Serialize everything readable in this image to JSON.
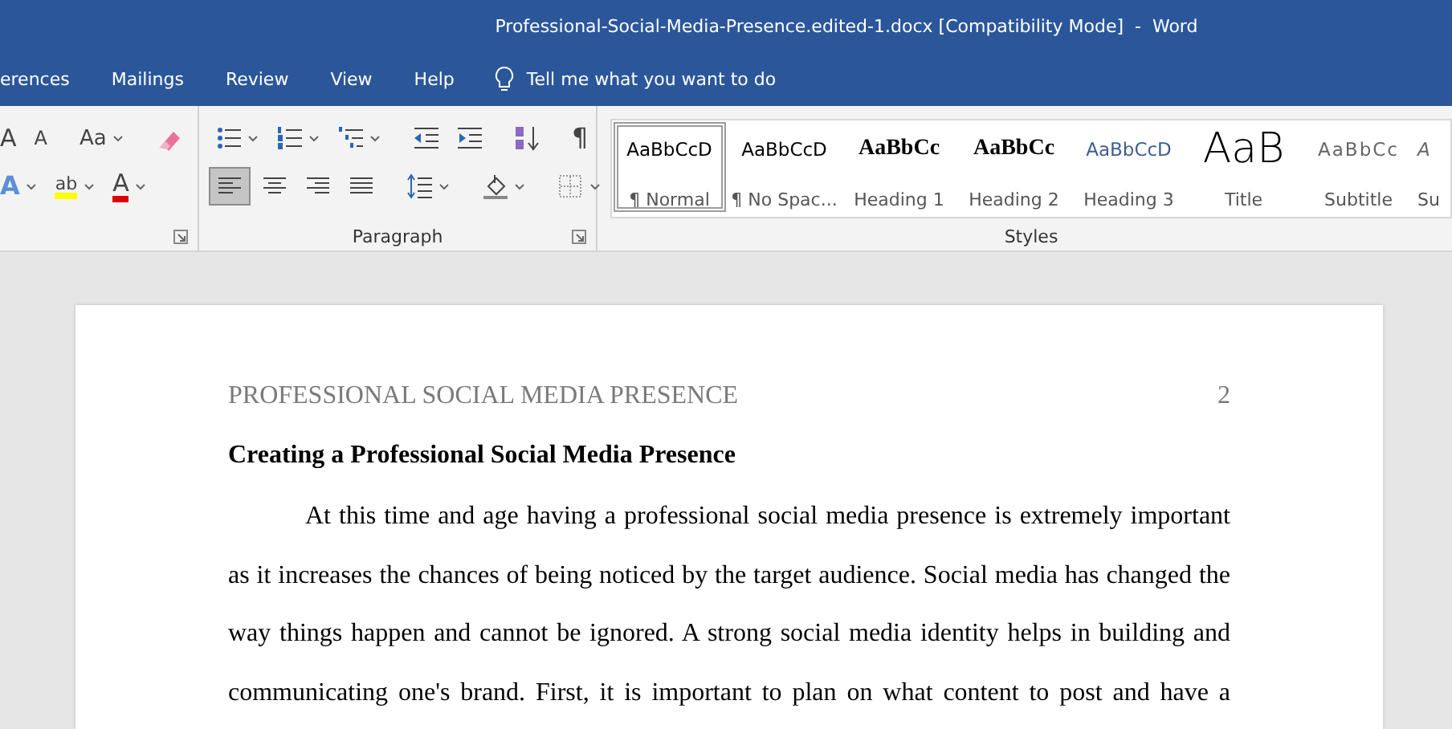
{
  "window": {
    "title": "Professional-Social-Media-Presence.edited-1.docx [Compatibility Mode]  -  Word"
  },
  "ribbon_tabs": [
    {
      "label": "erences",
      "selected": false
    },
    {
      "label": "Mailings",
      "selected": false
    },
    {
      "label": "Review",
      "selected": false
    },
    {
      "label": "View",
      "selected": false
    },
    {
      "label": "Help",
      "selected": false
    }
  ],
  "tell_me": {
    "label": "Tell me what you want to do"
  },
  "font_group": {
    "row_1": [
      {
        "kind": "grow-font",
        "glyph": "A",
        "dropdown": false
      },
      {
        "kind": "shrink-font",
        "glyph": "A",
        "dropdown": false
      },
      {
        "kind": "change-case",
        "glyph": "Aa",
        "dropdown": true
      },
      {
        "kind": "clear-formatting",
        "dropdown": false
      }
    ],
    "row_2": [
      {
        "kind": "text-effects",
        "glyph": "A",
        "dropdown": true
      },
      {
        "kind": "highlight",
        "glyph": "ab",
        "dropdown": true
      },
      {
        "kind": "font-color",
        "glyph": "A",
        "dropdown": true
      }
    ]
  },
  "paragraph_group": {
    "label": "Paragraph",
    "row_1": [
      {
        "kind": "bullets",
        "dropdown": true
      },
      {
        "kind": "numbering",
        "dropdown": true
      },
      {
        "kind": "multilevel",
        "dropdown": true
      },
      {
        "kind": "decrease-indent",
        "dropdown": false
      },
      {
        "kind": "increase-indent",
        "dropdown": false
      },
      {
        "kind": "sort",
        "dropdown": false
      },
      {
        "kind": "show-marks",
        "glyph": "¶",
        "dropdown": false
      }
    ],
    "alignment": [
      {
        "kind": "align-left",
        "selected": true
      },
      {
        "kind": "align-center",
        "selected": false
      },
      {
        "kind": "align-right",
        "selected": false
      },
      {
        "kind": "justify",
        "selected": false
      }
    ],
    "row_2": [
      {
        "kind": "line-spacing",
        "dropdown": true
      },
      {
        "kind": "shading",
        "dropdown": true
      },
      {
        "kind": "borders",
        "dropdown": true
      }
    ]
  },
  "styles_group": {
    "label": "Styles",
    "items": [
      {
        "kind": "normal",
        "preview": "AaBbCcD",
        "label": "¶ Normal",
        "selected": true
      },
      {
        "kind": "no-spacing",
        "preview": "AaBbCcD",
        "label": "¶ No Spac...",
        "selected": false
      },
      {
        "kind": "heading-1",
        "preview": "AaBbCc",
        "label": "Heading 1",
        "selected": false
      },
      {
        "kind": "heading-2",
        "preview": "AaBbCc",
        "label": "Heading 2",
        "selected": false
      },
      {
        "kind": "heading-3",
        "preview": "AaBbCcD",
        "label": "Heading 3",
        "selected": false
      },
      {
        "kind": "title",
        "preview": "AaB",
        "label": "Title",
        "selected": false
      },
      {
        "kind": "subtitle",
        "preview": "AaBbCc",
        "label": "Subtitle",
        "selected": false
      },
      {
        "kind": "subtle",
        "preview": "A",
        "label": "Su",
        "selected": false
      }
    ]
  },
  "document": {
    "header": "PROFESSIONAL SOCIAL MEDIA PRESENCE",
    "page_number": "2",
    "heading": "Creating a Professional Social Media Presence",
    "paragraph": "At this time and age having a professional social media presence is extremely important as it increases the chances of being noticed by the target audience. Social media has changed the way things happen and cannot be ignored. A strong social media identity helps in building and communicating one's brand. First, it is important to plan on what content to post and have a"
  }
}
